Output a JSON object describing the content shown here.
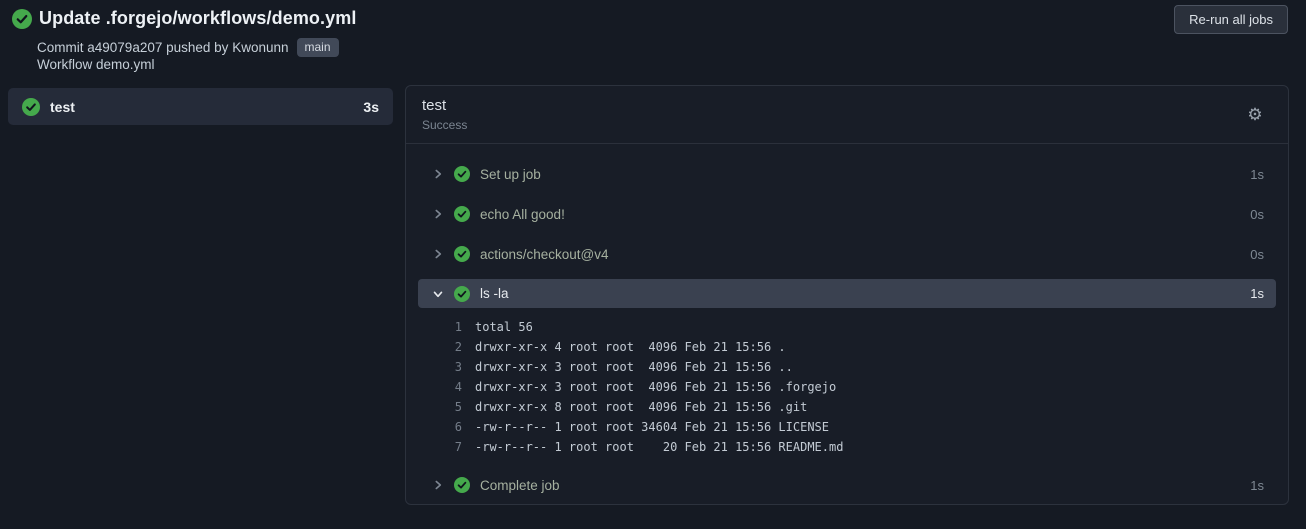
{
  "header": {
    "title": "Update .forgejo/workflows/demo.yml",
    "commit": {
      "prefix": "Commit",
      "sha": "a49079a207",
      "middle": "pushed by",
      "author": "Kwonunn",
      "branch_badge": "main"
    },
    "workflow_line": "Workflow demo.yml",
    "rerun_button_label": "Re-run all jobs",
    "status_icon": "success-check-circle"
  },
  "sidebar": {
    "jobs": [
      {
        "name": "test",
        "duration": "3s",
        "status": "success",
        "selected": true
      }
    ]
  },
  "main": {
    "job_title": "test",
    "job_status": "Success",
    "gear_icon": "gear-icon",
    "steps": [
      {
        "name": "Set up job",
        "duration": "1s",
        "status": "success",
        "expanded": false
      },
      {
        "name": "echo All good!",
        "duration": "0s",
        "status": "success",
        "expanded": false
      },
      {
        "name": "actions/checkout@v4",
        "duration": "0s",
        "status": "success",
        "expanded": false
      },
      {
        "name": "ls -la",
        "duration": "1s",
        "status": "success",
        "expanded": true,
        "logs": [
          {
            "num": "1",
            "text": "total 56"
          },
          {
            "num": "2",
            "text": "drwxr-xr-x 4 root root  4096 Feb 21 15:56 ."
          },
          {
            "num": "3",
            "text": "drwxr-xr-x 3 root root  4096 Feb 21 15:56 .."
          },
          {
            "num": "4",
            "text": "drwxr-xr-x 3 root root  4096 Feb 21 15:56 .forgejo"
          },
          {
            "num": "5",
            "text": "drwxr-xr-x 8 root root  4096 Feb 21 15:56 .git"
          },
          {
            "num": "6",
            "text": "-rw-r--r-- 1 root root 34604 Feb 21 15:56 LICENSE"
          },
          {
            "num": "7",
            "text": "-rw-r--r-- 1 root root    20 Feb 21 15:56 README.md"
          }
        ]
      },
      {
        "name": "Complete job",
        "duration": "1s",
        "status": "success",
        "expanded": false
      }
    ]
  },
  "colors": {
    "success_green": "#45a94c",
    "check_mark": "#10151d",
    "page_background": "#151a23",
    "panel_background": "#181d27",
    "selected_row": "#3a4150",
    "sidebar_selected": "#252b39",
    "step_label": "#a6b1a0"
  }
}
